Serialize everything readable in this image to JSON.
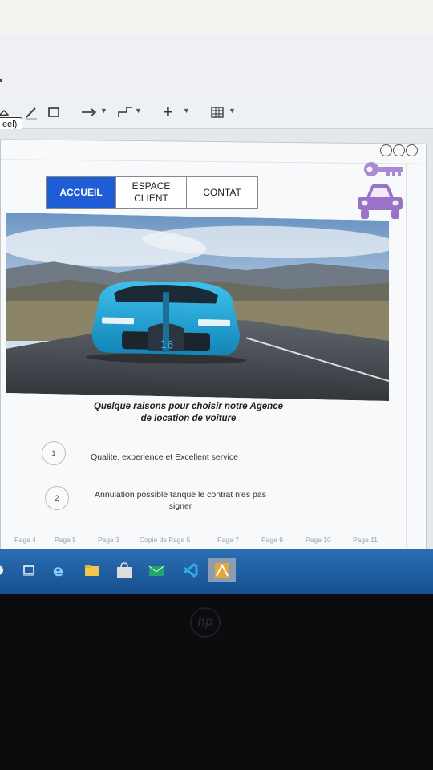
{
  "editor": {
    "name_tag": "eel)",
    "toolbar": {
      "icons": [
        "shape-icon",
        "pencil-icon",
        "rectangle-icon",
        "arrow-icon",
        "connector-icon",
        "plus-icon",
        "table-icon"
      ]
    }
  },
  "nav": {
    "items": [
      {
        "label": "ACCUEIL",
        "active": true
      },
      {
        "label": "ESPACE\nCLIENT",
        "active": false
      },
      {
        "label": "CONTAT",
        "active": false
      }
    ]
  },
  "hero": {
    "plate": "16"
  },
  "content": {
    "heading_line1": "Quelque raisons pour choisir notre Agence",
    "heading_line2": "de location de voiture",
    "reasons": [
      {
        "number": "1",
        "text": "Qualite, experience et Excellent service"
      },
      {
        "number": "2",
        "text_line1": "Annulation possible tanque le contrat n'es pas",
        "text_line2": "signer"
      }
    ]
  },
  "page_tabs": [
    "Page 4",
    "Page 5",
    "Page 3",
    "Copie de Page 5",
    "Page 7",
    "Page 9",
    "Page 10",
    "Page 11"
  ],
  "colors": {
    "accent": "#1e5dd6",
    "icon_purple": "#9b72c9",
    "car_blue": "#1fa9db",
    "taskbar": "#1b5fa8"
  }
}
